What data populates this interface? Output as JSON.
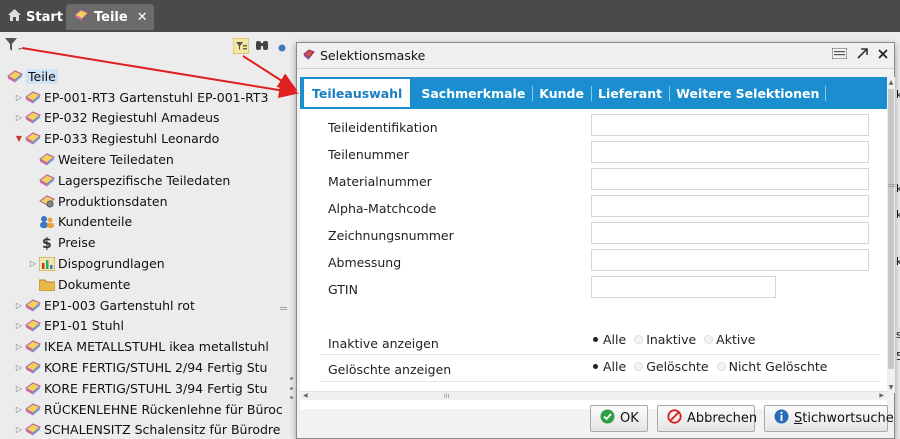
{
  "tabs": [
    {
      "label": "Start",
      "icon": "home-icon"
    },
    {
      "label": "Teile",
      "icon": "parts-icon",
      "close": "✕"
    }
  ],
  "tree": {
    "items": [
      {
        "label": "Teile",
        "level": 0,
        "arrow": "",
        "icon": "parts-icon",
        "selected": true
      },
      {
        "label": "EP-001-RT3  Gartenstuhl EP-001-RT3",
        "level": 1,
        "arrow": "▷",
        "icon": "parts-icon"
      },
      {
        "label": "EP-032  Regiestuhl Amadeus",
        "level": 1,
        "arrow": "▷",
        "icon": "parts-icon"
      },
      {
        "label": "EP-033  Regiestuhl Leonardo",
        "level": 1,
        "arrow": "▼",
        "icon": "parts-icon",
        "expanded": true
      },
      {
        "label": "Weitere Teiledaten",
        "level": 2,
        "arrow": "",
        "icon": "parts-icon"
      },
      {
        "label": "Lagerspezifische Teiledaten",
        "level": 2,
        "arrow": "",
        "icon": "parts-icon"
      },
      {
        "label": "Produktionsdaten",
        "level": 2,
        "arrow": "",
        "icon": "gear-parts-icon"
      },
      {
        "label": "Kundenteile",
        "level": 2,
        "arrow": "",
        "icon": "customers-icon"
      },
      {
        "label": "Preise",
        "level": 2,
        "arrow": "",
        "icon": "dollar-icon"
      },
      {
        "label": "Dispogrundlagen",
        "level": 2,
        "arrow": "▷",
        "icon": "chart-icon"
      },
      {
        "label": "Dokumente",
        "level": 2,
        "arrow": "",
        "icon": "folder-icon"
      },
      {
        "label": "EP1-003  Gartenstuhl rot",
        "level": 1,
        "arrow": "▷",
        "icon": "parts-icon"
      },
      {
        "label": "EP1-01  Stuhl",
        "level": 1,
        "arrow": "▷",
        "icon": "parts-icon"
      },
      {
        "label": "IKEA METALLSTUHL  ikea metallstuhl",
        "level": 1,
        "arrow": "▷",
        "icon": "parts-icon"
      },
      {
        "label": "KORE FERTIG/STUHL 2/94  Fertig Stu",
        "level": 1,
        "arrow": "▷",
        "icon": "parts-icon"
      },
      {
        "label": "KORE FERTIG/STUHL 3/94  Fertig Stu",
        "level": 1,
        "arrow": "▷",
        "icon": "parts-icon"
      },
      {
        "label": "RÜCKENLEHNE  Rückenlehne für Büroc",
        "level": 1,
        "arrow": "▷",
        "icon": "parts-icon"
      },
      {
        "label": "SCHALENSITZ  Schalensitz für Bürodre",
        "level": 1,
        "arrow": "▷",
        "icon": "parts-icon"
      }
    ]
  },
  "dialog": {
    "title": "Selektionsmaske",
    "tabs": [
      "Teileauswahl",
      "Sachmerkmale",
      "Kunde",
      "Lieferant",
      "Weitere Selektionen"
    ],
    "active_tab": "Teileauswahl",
    "fields": [
      {
        "label": "Teileidentifikation",
        "value": ""
      },
      {
        "label": "Teilenummer",
        "value": ""
      },
      {
        "label": "Materialnummer",
        "value": ""
      },
      {
        "label": "Alpha-Matchcode",
        "value": ""
      },
      {
        "label": "Zeichnungsnummer",
        "value": ""
      },
      {
        "label": "Abmessung",
        "value": ""
      },
      {
        "label": "GTIN",
        "value": ""
      }
    ],
    "radio_groups": [
      {
        "label": "Inaktive anzeigen",
        "options": [
          "Alle",
          "Inaktive",
          "Aktive"
        ],
        "selected": "Alle"
      },
      {
        "label": "Gelöschte anzeigen",
        "options": [
          "Alle",
          "Gelöschte",
          "Nicht Gelöschte"
        ],
        "selected": "Alle"
      }
    ],
    "buttons": {
      "ok": "OK",
      "cancel": "Abbrechen",
      "search_first": "S",
      "search_rest": "tichwortsuche"
    }
  },
  "colors": {
    "topbar": "#4a4a4a",
    "dialog_tab_bar": "#1a8ece",
    "annotation_arrow": "#e02020",
    "ok_icon": "#2e9e46",
    "cancel_icon": "#d42020",
    "info_icon": "#2a6db6"
  }
}
